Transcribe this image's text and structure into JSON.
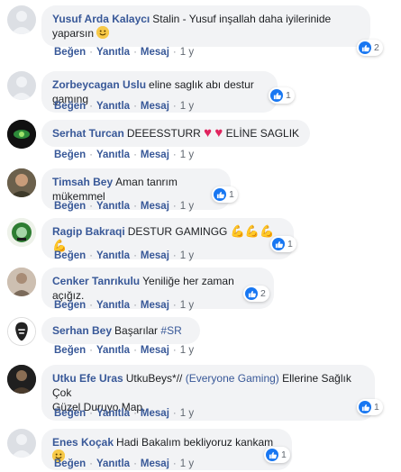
{
  "actions": {
    "like": "Beğen",
    "reply": "Yanıtla",
    "message": "Mesaj",
    "sep": "·"
  },
  "comments": [
    {
      "author": "Yusuf Arda Kalaycı",
      "text": "Stalin - Yusuf inşallah daha iyilerinide yaparsın",
      "time": "1 y",
      "reactions": "2"
    },
    {
      "author": "Zorbeycagan Uslu",
      "text": "eline saglık abı destur gamıng",
      "time": "1 y",
      "reactions": "1"
    },
    {
      "author": "Serhat Turcan",
      "text_a": "DEEESSTURR",
      "text_b": "ELİNE SAGLIK",
      "time": "1 y",
      "reactions": ""
    },
    {
      "author": "Timsah Bey",
      "text": "Aman tanrım mükemmel",
      "time": "1 y",
      "reactions": "1"
    },
    {
      "author": "Ragip Bakraqi",
      "text": "DESTUR GAMINGG",
      "time": "1 y",
      "reactions": "1"
    },
    {
      "author": "Cenker Tanrıkulu",
      "text": "Yeniliğe her zaman açığız.",
      "time": "1 y",
      "reactions": "2"
    },
    {
      "author": "Serhan Bey",
      "text": "Başarılar",
      "hashtag": "#SR",
      "time": "1 y",
      "reactions": ""
    },
    {
      "author": "Utku Efe Uras",
      "text_a": "UtkuBeys*//",
      "link": "(Everyone Gaming)",
      "text_b": "Ellerine Sağlık Çok",
      "text_c": "Güzel Duruyo Map.",
      "time": "1 y",
      "reactions": "1"
    },
    {
      "author": "Enes Koçak",
      "text": "Hadi Bakalım bekliyoruz kankam",
      "time": "1 y",
      "reactions": "1"
    }
  ],
  "colors": {
    "author": "#385898",
    "bubble": "#f2f3f5",
    "like_blue": "#1877f2",
    "heart": "#e0245e"
  }
}
